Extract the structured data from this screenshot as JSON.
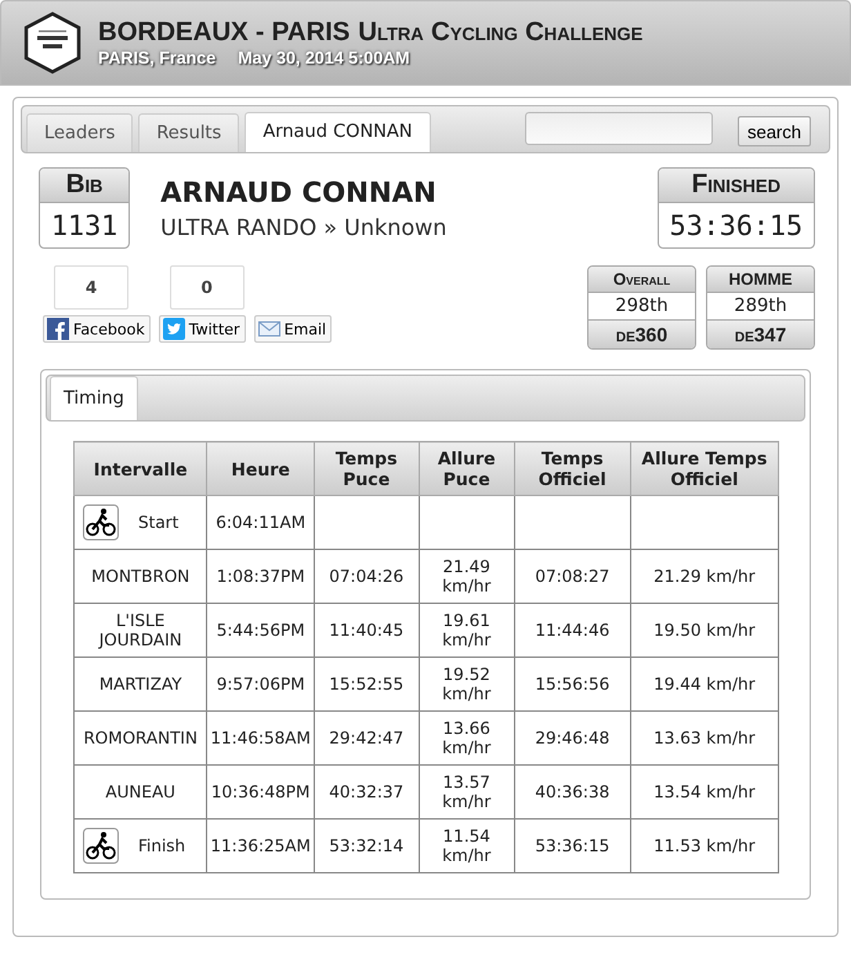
{
  "header": {
    "title": "BORDEAUX - PARIS",
    "subtitle": "Ultra Cycling Challenge",
    "location": "PARIS, France",
    "date": "May 30, 2014 5:00AM"
  },
  "tabs": [
    {
      "label": "Leaders",
      "selected": false
    },
    {
      "label": "Results",
      "selected": false
    },
    {
      "label": "Arnaud CONNAN",
      "selected": true
    }
  ],
  "search": {
    "button": "search"
  },
  "athlete": {
    "bib_label": "Bib",
    "bib": "1131",
    "name": "ARNAUD CONNAN",
    "category": "ULTRA RANDO » Unknown",
    "status_label": "Finished",
    "time": "53:36:15"
  },
  "social": [
    {
      "kind": "facebook",
      "count": "4",
      "label": "Facebook"
    },
    {
      "kind": "twitter",
      "count": "0",
      "label": "Twitter"
    },
    {
      "kind": "email",
      "label": "Email"
    }
  ],
  "ranks": [
    {
      "label": "Overall",
      "place": "298th",
      "total": "de360"
    },
    {
      "label": "HOMME",
      "place": "289th",
      "total": "de347"
    }
  ],
  "section_tabs": [
    {
      "label": "Timing",
      "selected": true
    }
  ],
  "table": {
    "columns": [
      "Intervalle",
      "Heure",
      "Temps Puce",
      "Allure Puce",
      "Temps Officiel",
      "Allure Temps Officiel"
    ],
    "rows": [
      {
        "kind": "bike",
        "cells": [
          "Start",
          "6:04:11AM",
          "",
          "",
          "",
          ""
        ]
      },
      {
        "kind": "point",
        "cells": [
          "MONTBRON",
          "1:08:37PM",
          "07:04:26",
          "21.49 km/hr",
          "07:08:27",
          "21.29 km/hr"
        ]
      },
      {
        "kind": "point",
        "cells": [
          "L'ISLE JOURDAIN",
          "5:44:56PM",
          "11:40:45",
          "19.61 km/hr",
          "11:44:46",
          "19.50 km/hr"
        ]
      },
      {
        "kind": "point",
        "cells": [
          "MARTIZAY",
          "9:57:06PM",
          "15:52:55",
          "19.52 km/hr",
          "15:56:56",
          "19.44 km/hr"
        ]
      },
      {
        "kind": "point",
        "cells": [
          "ROMORANTIN",
          "11:46:58AM",
          "29:42:47",
          "13.66 km/hr",
          "29:46:48",
          "13.63 km/hr"
        ]
      },
      {
        "kind": "point",
        "cells": [
          "AUNEAU",
          "10:36:48PM",
          "40:32:37",
          "13.57 km/hr",
          "40:36:38",
          "13.54 km/hr"
        ]
      },
      {
        "kind": "bike",
        "cells": [
          "Finish",
          "11:36:25AM",
          "53:32:14",
          "11.54 km/hr",
          "53:36:15",
          "11.53 km/hr"
        ]
      }
    ]
  }
}
